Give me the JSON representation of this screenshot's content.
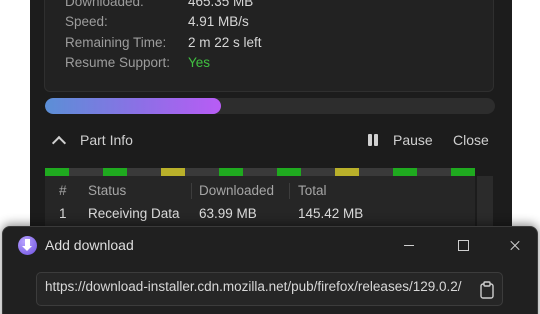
{
  "info": {
    "rows": [
      {
        "label": "Downloaded:",
        "value": "465.35 MB"
      },
      {
        "label": "Speed:",
        "value": "4.91 MB/s"
      },
      {
        "label": "Remaining Time:",
        "value": "2 m 22 s left"
      },
      {
        "label": "Resume Support:",
        "value": "Yes"
      }
    ],
    "resume_color": "#40c040"
  },
  "progress": {
    "fraction": 0.39,
    "gradient": [
      "#5b8fd6",
      "#b85cf5"
    ]
  },
  "part_bar": {
    "toggle_label": "Part Info",
    "pause_label": "Pause",
    "close_label": "Close"
  },
  "segments": [
    {
      "color": "#1faa1f"
    },
    {
      "color": "#1faa1f"
    },
    {
      "color": "#b9b02a"
    },
    {
      "color": "#1faa1f"
    },
    {
      "color": "#1faa1f"
    },
    {
      "color": "#b9b02a"
    },
    {
      "color": "#1faa1f"
    },
    {
      "color": "#1faa1f"
    }
  ],
  "table": {
    "headers": [
      "#",
      "Status",
      "Downloaded",
      "Total"
    ],
    "rows": [
      {
        "num": "1",
        "status": "Receiving Data",
        "downloaded": "63.99 MB",
        "total": "145.42 MB"
      }
    ]
  },
  "dialog": {
    "title": "Add download",
    "url": "https://download-installer.cdn.mozilla.net/pub/firefox/releases/129.0.2/"
  }
}
